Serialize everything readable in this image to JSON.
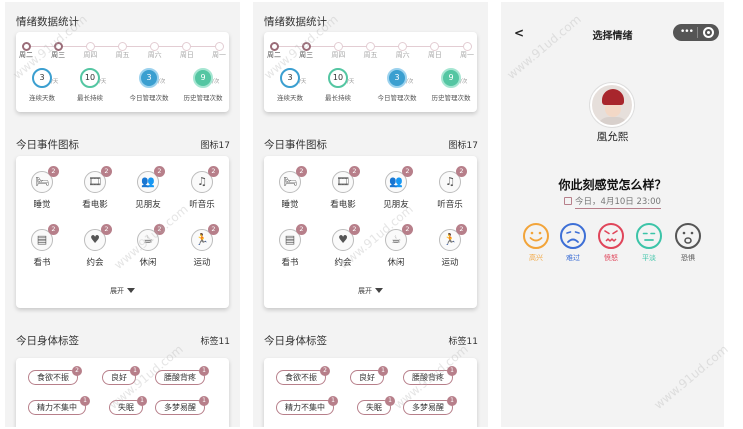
{
  "screens": [
    {
      "stats": {
        "title": "情绪数据统计"
      },
      "events": {
        "title": "今日事件图标",
        "count": "图标17",
        "expand_label": "展开"
      },
      "tags": {
        "title": "今日身体标签",
        "count": "标签11"
      }
    },
    {
      "stats": {
        "title": "情绪数据统计"
      },
      "events": {
        "title": "今日事件图标",
        "count": "图标17",
        "expand_label": "展开"
      },
      "tags": {
        "title": "今日身体标签",
        "count": "标签11"
      }
    }
  ],
  "days": [
    "周二",
    "周三",
    "周四",
    "周五",
    "周六",
    "周日",
    "周一"
  ],
  "active_days": [
    0,
    1
  ],
  "metrics": [
    {
      "value": "3",
      "unit": "/天",
      "label": "连续天数",
      "style": "blue"
    },
    {
      "value": "10",
      "unit": "/天",
      "label": "最长持续",
      "style": "green"
    },
    {
      "value": "3",
      "unit": "/次",
      "label": "今日管理次数",
      "style": "fill-blue"
    },
    {
      "value": "9",
      "unit": "/次",
      "label": "历史管理次数",
      "style": "fill-green"
    }
  ],
  "events": [
    {
      "icon": "bed-icon",
      "glyph": "🛏",
      "badge": "2",
      "label": "睡觉"
    },
    {
      "icon": "film-icon",
      "glyph": "🎞",
      "badge": "2",
      "label": "看电影"
    },
    {
      "icon": "friends-icon",
      "glyph": "👥",
      "badge": "2",
      "label": "见朋友"
    },
    {
      "icon": "music-icon",
      "glyph": "♫",
      "badge": "2",
      "label": "听音乐"
    },
    {
      "icon": "book-icon",
      "glyph": "▤",
      "badge": "2",
      "label": "看书"
    },
    {
      "icon": "heart-icon",
      "glyph": "♥",
      "badge": "2",
      "label": "约会"
    },
    {
      "icon": "drink-icon",
      "glyph": "☕",
      "badge": "2",
      "label": "休闲"
    },
    {
      "icon": "run-icon",
      "glyph": "🏃",
      "badge": "2",
      "label": "运动"
    }
  ],
  "body_tags": [
    {
      "label": "食欲不振",
      "badge": "2"
    },
    {
      "label": "良好",
      "badge": "1"
    },
    {
      "label": "腰酸背疼",
      "badge": "1"
    },
    {
      "label": "精力不集中",
      "badge": "1"
    },
    {
      "label": "失眠",
      "badge": "1"
    },
    {
      "label": "多梦易醒",
      "badge": "1"
    }
  ],
  "mood_screen": {
    "nav_title": "选择情绪",
    "back_glyph": "<",
    "capsule_dots": "•••",
    "user_name": "凰允熙",
    "question": "你此刻感觉怎么样？",
    "date": "今日，4月10日  23:00",
    "moods": [
      {
        "label": "高兴",
        "color": "#f2a43a",
        "face": "happy"
      },
      {
        "label": "难过",
        "color": "#3d6fd6",
        "face": "sad"
      },
      {
        "label": "愤怒",
        "color": "#e0455a",
        "face": "angry"
      },
      {
        "label": "平淡",
        "color": "#3cc4a8",
        "face": "neutral"
      },
      {
        "label": "恐惧",
        "color": "#555555",
        "face": "fear"
      }
    ]
  },
  "watermark": "www.91ud.com"
}
